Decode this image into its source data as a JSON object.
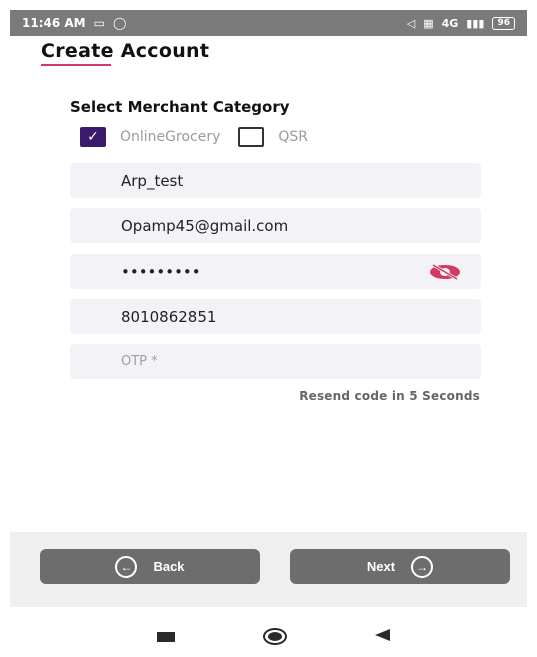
{
  "status_bar": {
    "time": "11:46 AM",
    "network": "4G",
    "battery": "96"
  },
  "page": {
    "title": "Create Account",
    "accent_color": "#d33a63"
  },
  "merchant_category": {
    "label": "Select Merchant Category",
    "options": [
      {
        "label": "OnlineGrocery",
        "checked": true
      },
      {
        "label": "QSR",
        "checked": false
      }
    ]
  },
  "form": {
    "name_value": "Arp_test",
    "email_value": "Opamp45@gmail.com",
    "password_value": "•••••••••",
    "phone_value": "8010862851",
    "otp_placeholder": "OTP *"
  },
  "resend_text": "Resend code in 5 Seconds",
  "buttons": {
    "back_label": "Back",
    "next_label": "Next"
  },
  "icons": {
    "back": "arrow-left-circle-icon",
    "next": "arrow-right-circle-icon",
    "password_toggle": "eye-off-icon"
  }
}
